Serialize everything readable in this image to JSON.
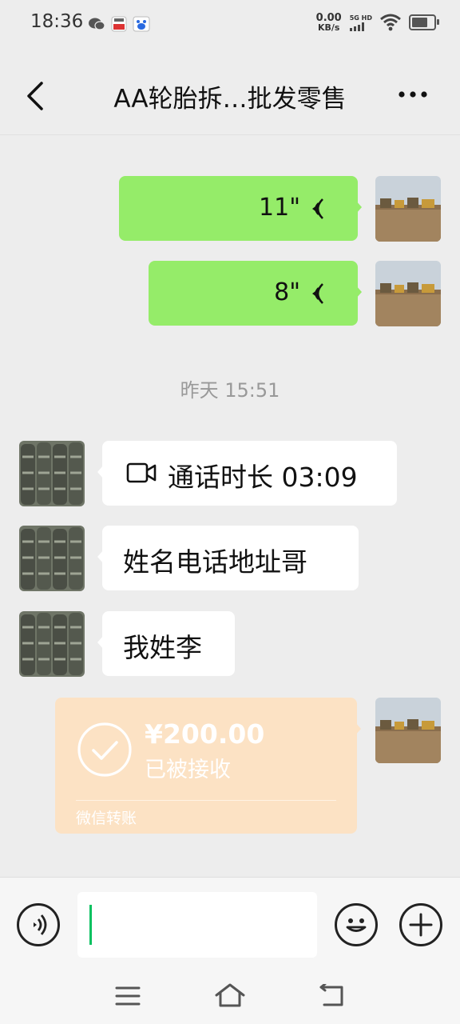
{
  "status_bar": {
    "time": "18:36",
    "net_speed_value": "0.00",
    "net_speed_unit": "KB/s",
    "network": "5G HD"
  },
  "header": {
    "title": "AA轮胎拆…批发零售"
  },
  "messages": [
    {
      "side": "right",
      "type": "voice",
      "duration": "11\""
    },
    {
      "side": "right",
      "type": "voice",
      "duration": "8\""
    },
    {
      "type": "timestamp",
      "text": "昨天 15:51"
    },
    {
      "side": "left",
      "type": "video_call",
      "text": "通话时长 03:09"
    },
    {
      "side": "left",
      "type": "text",
      "text": "姓名电话地址哥"
    },
    {
      "side": "left",
      "type": "text",
      "text": "我姓李"
    },
    {
      "side": "right",
      "type": "transfer",
      "amount": "¥200.00",
      "status": "已被接收",
      "footer": "微信转账"
    }
  ],
  "input": {
    "value": "",
    "placeholder": ""
  },
  "colors": {
    "background": "#ededed",
    "sent_bubble": "#95ec69",
    "received_bubble": "#ffffff",
    "transfer_bubble": "#fce2c4",
    "cursor": "#07c160"
  },
  "battery_level": 0.8
}
